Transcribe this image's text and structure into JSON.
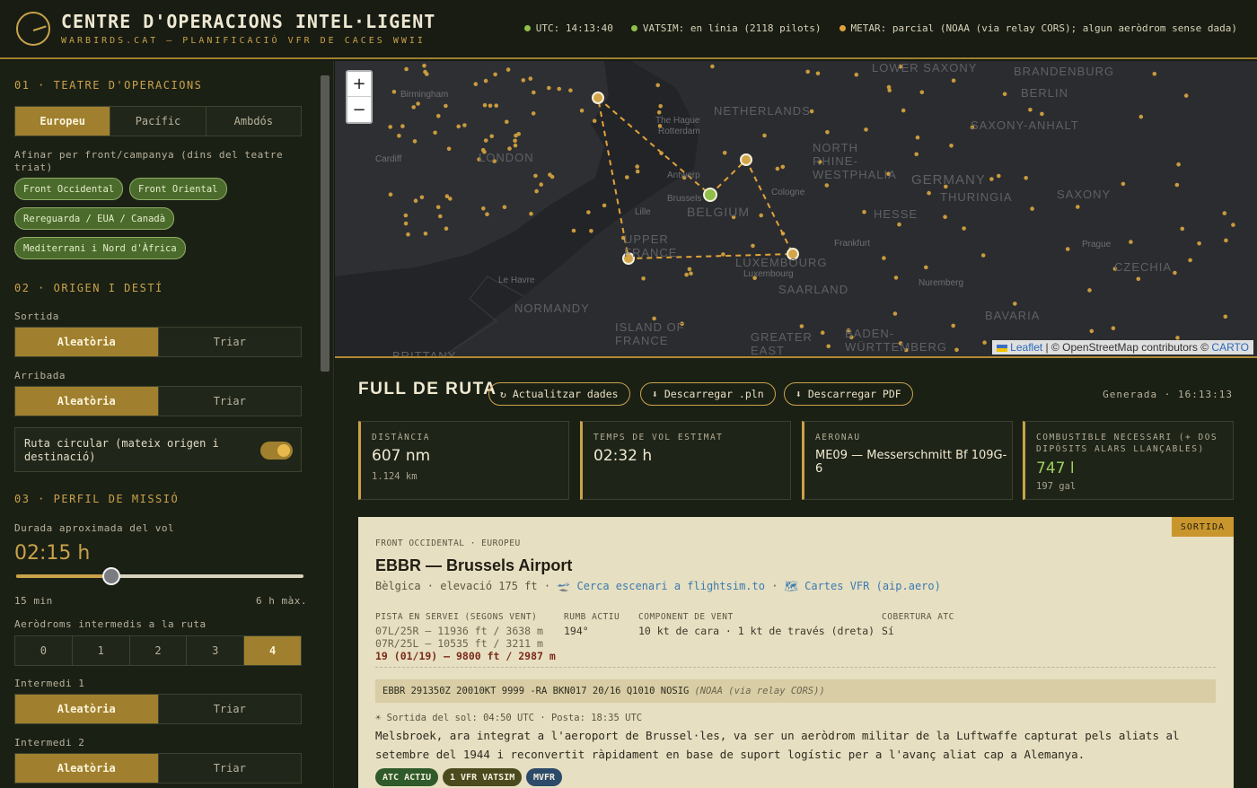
{
  "header": {
    "title": "CENTRE D'OPERACIONS INTEL·LIGENT",
    "subtitle": "WARBIRDS.CAT — PLANIFICACIÓ VFR DE CACES WWII",
    "status": [
      {
        "text": "UTC: 14:13:40",
        "color": "#8fbf4a"
      },
      {
        "text": "VATSIM: en línia (2118 pilots)",
        "color": "#8fbf4a"
      },
      {
        "text": "METAR: parcial (NOAA (via relay CORS); algun aeròdrom sense dada)",
        "color": "#e0a33a"
      }
    ]
  },
  "sidebar": {
    "sec1": "01 · TEATRE D'OPERACIONS",
    "theatre": [
      "Europeu",
      "Pacífic",
      "Ambdós"
    ],
    "refine_label": "Afinar per front/campanya (dins del teatre triat)",
    "fronts": [
      "Front Occidental",
      "Front Oriental",
      "Rereguarda / EUA / Canadà",
      "Mediterrani i Nord d'Àfrica"
    ],
    "sec2": "02 · ORIGEN I DESTÍ",
    "departure_label": "Sortida",
    "arrival_label": "Arribada",
    "random": "Aleatòria",
    "choose": "Triar",
    "circular_label": "Ruta circular (mateix origen i destinació)",
    "sec3": "03 · PERFIL DE MISSIÓ",
    "duration_label": "Durada aproximada del vol",
    "duration_value": "02:15 h",
    "duration_fraction": 0.33,
    "slider_min": "15 min",
    "slider_max": "6 h màx.",
    "intermediate_label": "Aeròdroms intermedis a la ruta",
    "intermediate_options": [
      "0",
      "1",
      "2",
      "3",
      "4"
    ],
    "intermediate1_label": "Intermedi 1",
    "intermediate2_label": "Intermedi 2"
  },
  "map": {
    "zoom_in": "+",
    "zoom_out": "−",
    "attribution_leaflet": "Leaflet",
    "attribution_rest": " | © OpenStreetMap contributors © ",
    "attribution_carto": "CARTO",
    "labels": [
      "LOWER SAXONY",
      "BRANDENBURG",
      "BERLIN",
      "Birmingham",
      "NETHERLANDS",
      "The Hague",
      "Rotterdam",
      "SAXONY-ANHALT",
      "Cardiff",
      "LONDON",
      "NORTH RHINE-WESTPHALIA",
      "GERMANY",
      "THURINGIA",
      "SAXONY",
      "Antwerp",
      "Brussels",
      "BELGIUM",
      "Cologne",
      "Lille",
      "HESSE",
      "UPPER FRANCE",
      "Frankfurt",
      "Prague",
      "LUXEMBOURG",
      "Luxembourg",
      "CZECHIA",
      "Le Havre",
      "SAARLAND",
      "Nuremberg",
      "NORMANDY",
      "BAVARIA",
      "ISLAND OF FRANCE",
      "GREATER EAST",
      "BADEN-WÜRTTEMBERG",
      "BRITTANY"
    ]
  },
  "route": {
    "title": "FULL DE RUTA",
    "refresh": "↻ Actualitzar dades",
    "download_pln": "⬇ Descarregar .pln",
    "download_pdf": "⬇ Descarregar PDF",
    "generated_label": "Generada · 16:13:13",
    "stats": [
      {
        "label": "DISTÀNCIA",
        "value": "607 nm",
        "sub": "1.124 km",
        "value_color": "#f1ead2"
      },
      {
        "label": "TEMPS DE VOL ESTIMAT",
        "value": "02:32 h",
        "sub": "",
        "value_color": "#f1ead2"
      },
      {
        "label": "AERONAU",
        "value": "ME09 — Messerschmitt Bf 109G-6",
        "sub": "",
        "value_color": "#f1ead2"
      },
      {
        "label": "COMBUSTIBLE NECESSARI (+ DOS DIPÒSITS ALARS LLANÇABLES)",
        "value": "747 l",
        "sub": "197 gal",
        "value_color": "#9fd35a"
      }
    ]
  },
  "airport": {
    "tag": "SORTIDA",
    "front": "FRONT OCCIDENTAL · EUROPEU",
    "name": "EBBR — Brussels Airport",
    "meta_country": "Bèlgica · elevació 175 ft · ",
    "meta_link1": "🛫 Cerca escenari a flightsim.to",
    "meta_sep": " · ",
    "meta_link2": "🗺 Cartes VFR (aip.aero)",
    "runway_label": "PISTA EN SERVEI (SEGONS VENT)",
    "runways": [
      "07L/25R — 11936 ft / 3638 m",
      "07R/25L — 10535 ft / 3211 m"
    ],
    "active_runway": "19 (01/19) — 9800 ft / 2987 m",
    "heading_label": "RUMB ACTIU",
    "heading": "194°",
    "wind_label": "COMPONENT DE VENT",
    "wind": "10 kt de cara · 1 kt de través (dreta)",
    "atc_label": "COBERTURA ATC",
    "atc": "Sí",
    "metar": "EBBR 291350Z 20010KT 9999 -RA BKN017 20/16 Q1010 NOSIG",
    "metar_source": "(NOAA (via relay CORS))",
    "sun": "☀ Sortida del sol: 04:50 UTC · Posta: 18:35 UTC",
    "description": "Melsbroek, ara integrat a l'aeroport de Brussel·les, va ser un aeròdrom militar de la Luftwaffe capturat pels aliats al setembre del 1944 i reconvertit ràpidament en base de suport logístic per a l'avanç aliat cap a Alemanya.",
    "badges": [
      {
        "text": "ATC ACTIU",
        "color": "#2f5a2a"
      },
      {
        "text": "1 VFR VATSIM",
        "color": "#4a4a1e"
      },
      {
        "text": "MVFR",
        "color": "#2c4a6a"
      }
    ]
  }
}
